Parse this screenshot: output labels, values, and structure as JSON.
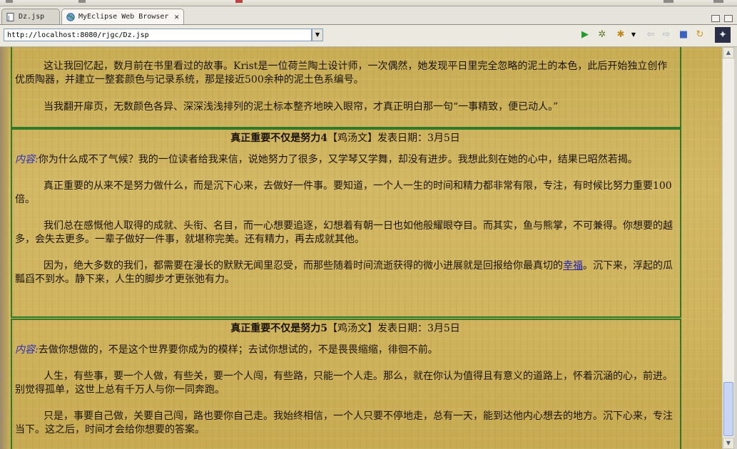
{
  "tabs": [
    {
      "label": "Dz.jsp",
      "icon": "jsp-file-icon",
      "active": false
    },
    {
      "label": "MyEclipse Web Browser",
      "icon": "globe-icon",
      "active": true,
      "close": "✕"
    }
  ],
  "address": {
    "url": "http://localhost:8080/rjgc/Dz.jsp"
  },
  "toolbar_icons": [
    "run-icon",
    "debug-icon",
    "server-icon",
    "back-icon",
    "forward-icon",
    "stop-icon",
    "refresh-icon",
    "myeclipse-logo-icon"
  ],
  "colors": {
    "border": "#2f7a2a",
    "label": "#2d2db8",
    "link": "#1f1fb0",
    "background": "#cfb35d"
  },
  "blocks": [
    {
      "paragraphs": [
        "这让我回忆起，数月前在书里看过的故事。Krist是一位荷兰陶土设计师，一次偶然，她发现平日里完全忽略的泥土的本色，此后开始独立创作优质陶器，并建立一整套颜色与记录系统，那是接近500余种的泥土色系编号。",
        "当我翻开扉页，无数颜色各异、深深浅浅排列的泥土标本整齐地映入眼帘，才真正明白那一句“一事精致，便已动人。”"
      ]
    },
    {
      "title": "真正重要不仅是努力4",
      "meta": "【鸡汤文】发表日期：3月5日",
      "label": "内容:",
      "intro": "你为什么成不了气候？我的一位读者给我来信，说她努力了很多，又学琴又学舞，却没有进步。我想此刻在她的心中，结果已昭然若揭。",
      "paragraphs": [
        "真正重要的从来不是努力做什么，而是沉下心来，去做好一件事。要知道，一个人一生的时间和精力都非常有限，专注，有时候比努力重要100倍。",
        "我们总在感慨他人取得的成就、头衔、名目，而一心想要追逐，幻想着有朝一日也如他般耀眼夺目。而其实，鱼与熊掌，不可兼得。你想要的越多，会失去更多。一辈子做好一件事，就堪称完美。还有精力，再去成就其他。"
      ],
      "last_before": "因为，绝大多数的我们，都需要在漫长的默默无闻里忍受，而那些随着时间流逝获得的微小进展就是回报给你最真切的",
      "link": "幸福",
      "last_after": "。沉下来，浮起的瓜瓢舀不到水。静下来，人生的脚步才更张弛有力。"
    },
    {
      "title": "真正重要不仅是努力5",
      "meta": "【鸡汤文】发表日期：3月5日",
      "label": "内容:",
      "intro": "去做你想做的，不是这个世界要你成为的模样；去试你想试的，不是畏畏缩缩，徘徊不前。",
      "paragraphs": [
        "人生，有些事，要一个人做，有些关，要一个人闯，有些路，只能一个人走。那么，就在你认为值得且有意义的道路上，怀着沉涵的心，前进。别觉得孤单，这世上总有千万人与你一同奔跑。",
        "只是，事要自己做，关要自己闯，路也要你自己走。我始终相信，一个人只要不停地走，总有一天，能到达他内心想去的地方。沉下心来，专注当下。这之后，时间才会给你想要的答案。"
      ]
    }
  ]
}
